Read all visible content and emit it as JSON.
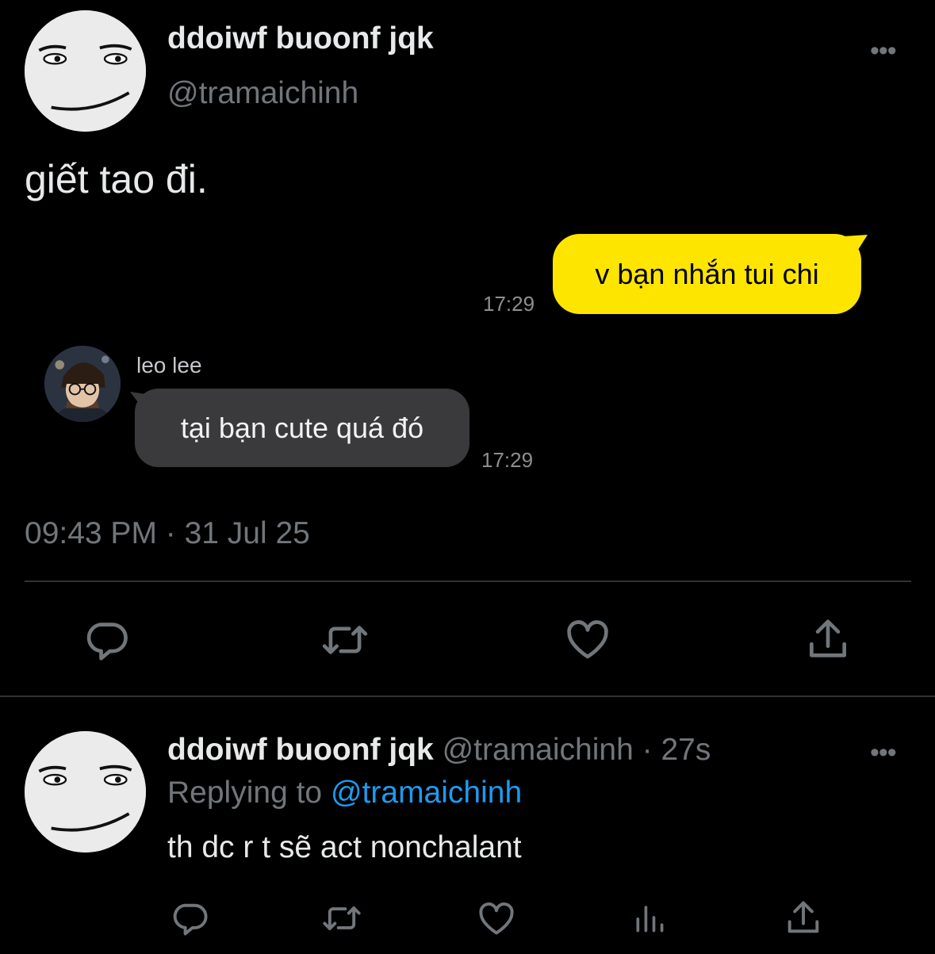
{
  "tweet": {
    "display_name": "ddoiwf buoonf jqk",
    "handle": "@tramaichinh",
    "more": "•••",
    "text": "giết tao đi.",
    "timestamp": "09:43 PM · 31 Jul 25"
  },
  "chat": {
    "outgoing_message": "v bạn nhắn tui chi",
    "outgoing_time": "17:29",
    "incoming_sender": "leo lee",
    "incoming_message": "tại bạn cute quá đó",
    "incoming_time": "17:29",
    "outgoing_bubble_color": "#fee500",
    "incoming_bubble_color": "#3a3a3c"
  },
  "actions": {
    "icons": [
      "reply-icon",
      "retweet-icon",
      "like-icon",
      "share-icon"
    ]
  },
  "reply": {
    "display_name": "ddoiwf buoonf jqk",
    "handle": "@tramaichinh",
    "separator": "·",
    "age": "27s",
    "more": "•••",
    "replying_prefix": "Replying to",
    "replying_handle": "@tramaichinh",
    "text": "th dc r t sẽ act nonchalant",
    "icons": [
      "reply-icon",
      "retweet-icon",
      "like-icon",
      "views-icon",
      "share-icon"
    ]
  },
  "colors": {
    "background": "#000000",
    "text": "#e7e9ea",
    "muted": "#71767b",
    "link": "#1d9bf0",
    "divider": "#2f3336"
  }
}
